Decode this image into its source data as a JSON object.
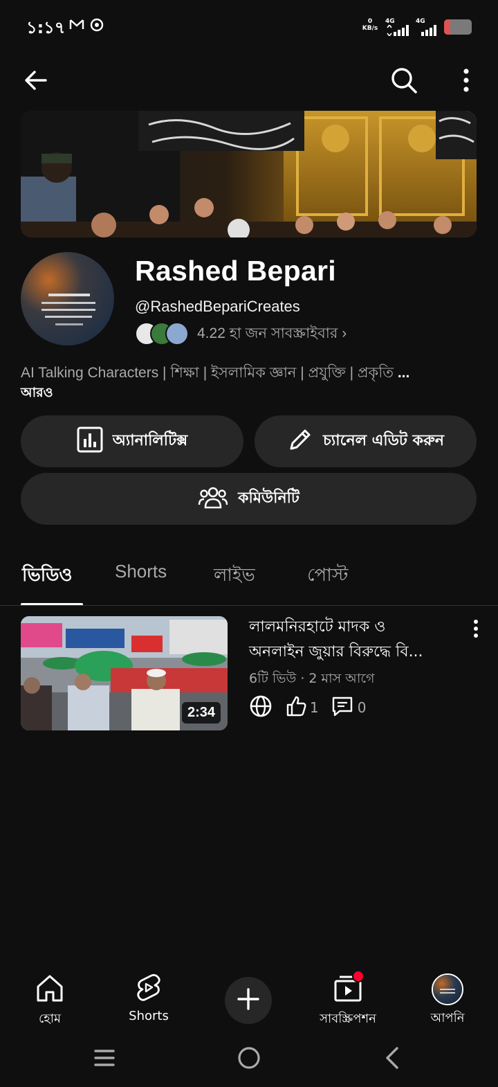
{
  "status_bar": {
    "time": "১:১৭",
    "net_speed_value": "0",
    "net_speed_unit": "KB/s",
    "network1": "4G",
    "network2": "4G",
    "battery_color": "#e05252"
  },
  "top_bar": {
    "back_icon": "arrow-left",
    "search_icon": "search",
    "more_icon": "more-vertical"
  },
  "channel": {
    "name": "Rashed Bepari",
    "handle": "@RashedBepariCreates",
    "subscribers": "4.22 হা জন সাবস্ক্রাইবার ›",
    "description": "AI Talking Characters | শিক্ষা | ইসলামিক জ্ঞান | প্রযুক্তি | প্রকৃতি ",
    "description_ellipsis": "...",
    "more_label": "আরও"
  },
  "actions": {
    "analytics_label": "অ্যানালিটিক্স",
    "edit_label": "চ্যানেল এডিট করুন",
    "community_label": "কমিউনিটি"
  },
  "tabs": [
    {
      "label": "ভিডিও",
      "active": true
    },
    {
      "label": "Shorts",
      "active": false
    },
    {
      "label": "লাইভ",
      "active": false
    },
    {
      "label": "পোস্ট",
      "active": false
    }
  ],
  "videos": [
    {
      "title": "লালমনিরহাটে মাদক ও অনলাইন জুয়ার বিরুদ্ধে বি...",
      "title_line1": "লালমনিরহাটে মাদক ও",
      "title_line2": "অনলাইন জুয়ার বিরুদ্ধে বি...",
      "meta": "6টি ভিউ · 2 মাস আগে",
      "duration": "2:34",
      "likes": "1",
      "comments": "0",
      "visibility_icon": "globe"
    }
  ],
  "bottom_nav": {
    "home_label": "হোম",
    "shorts_label": "Shorts",
    "subs_label": "সাবস্ক্রিপশন",
    "you_label": "আপনি",
    "notification_color": "#ff0033"
  },
  "accent_colors": {
    "background": "#0f0f0f",
    "surface": "#272727",
    "secondary_text": "#aaaaaa"
  }
}
